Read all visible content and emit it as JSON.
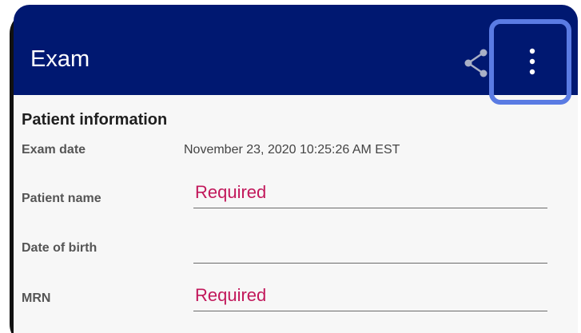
{
  "app": {
    "title": "Exam"
  },
  "colors": {
    "appbar": "#001871",
    "required": "#c2185b",
    "highlight": "#5a7be3"
  },
  "icons": {
    "share": "share-icon",
    "overflow": "more-vert-icon"
  },
  "patient": {
    "section_title": "Patient information",
    "exam_date_label": "Exam date",
    "exam_date_value": "November 23, 2020 10:25:26 AM EST",
    "name_label": "Patient name",
    "name_value": "Required",
    "dob_label": "Date of birth",
    "dob_value": "",
    "mrn_label": "MRN",
    "mrn_value": "Required"
  }
}
